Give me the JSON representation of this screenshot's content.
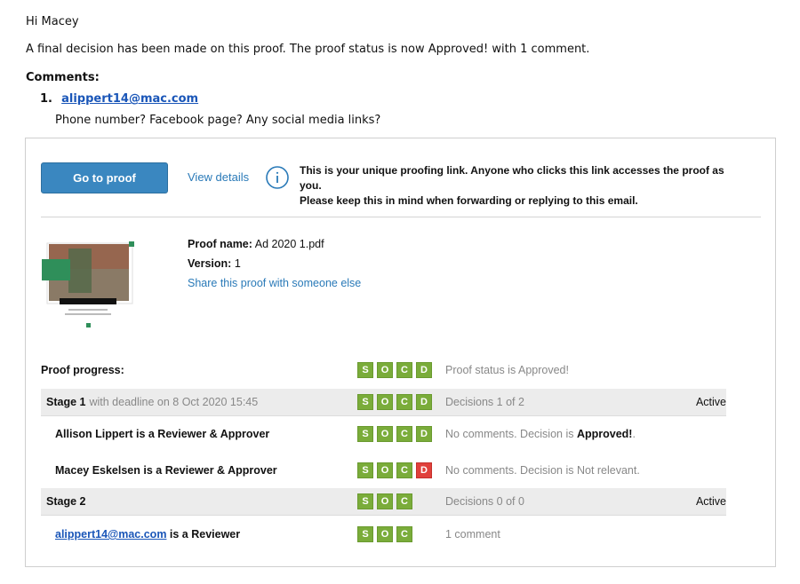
{
  "greeting": "Hi Macey",
  "intro": "A final decision has been made on this proof. The proof status is now Approved! with 1 comment.",
  "comments": {
    "title": "Comments:",
    "items": [
      {
        "number": "1.",
        "author": "alippert14@mac.com",
        "text": "Phone number? Facebook page? Any social media links?"
      }
    ]
  },
  "actions": {
    "go_to_proof": "Go to proof",
    "view_details": "View details",
    "info_line1": "This is your unique proofing link. Anyone who clicks this link accesses the proof as you.",
    "info_line2": "Please keep this in mind when forwarding or replying to this email."
  },
  "proof": {
    "name_label": "Proof name:",
    "name": "Ad 2020 1.pdf",
    "version_label": "Version:",
    "version": "1",
    "share": "Share this proof with someone else"
  },
  "progress": {
    "label": "Proof progress:",
    "status": "Proof status is Approved!",
    "badges": [
      "S",
      "O",
      "C",
      "D"
    ]
  },
  "stages": [
    {
      "name": "Stage 1",
      "deadline": "with deadline on 8 Oct 2020 15:45",
      "decisions": "Decisions 1 of 2",
      "state": "Active",
      "badges": [
        "S",
        "O",
        "C",
        "D"
      ],
      "reviewers": [
        {
          "name": "Allison Lippert is a Reviewer & Approver",
          "status_prefix": "No comments. Decision is ",
          "status_value": "Approved!",
          "status_suffix": ".",
          "badges": [
            "S",
            "O",
            "C",
            "D"
          ],
          "decision_color": "green"
        },
        {
          "name": "Macey Eskelsen is a Reviewer & Approver",
          "status_prefix": "No comments. Decision is Not relevant.",
          "badges": [
            "S",
            "O",
            "C",
            "D"
          ],
          "decision_color": "red"
        }
      ]
    },
    {
      "name": "Stage 2",
      "decisions": "Decisions 0 of 0",
      "state": "Active",
      "badges": [
        "S",
        "O",
        "C"
      ],
      "reviewers": [
        {
          "email": "alippert14@mac.com",
          "role": " is a Reviewer",
          "status": "1 comment",
          "badges": [
            "S",
            "O",
            "C"
          ]
        }
      ]
    }
  ],
  "icons": {
    "info": "info-circle-icon"
  },
  "colors": {
    "button": "#3a87c0",
    "link": "#2a7ab8",
    "badge_green": "#7aac3a",
    "badge_red": "#e0403b"
  }
}
